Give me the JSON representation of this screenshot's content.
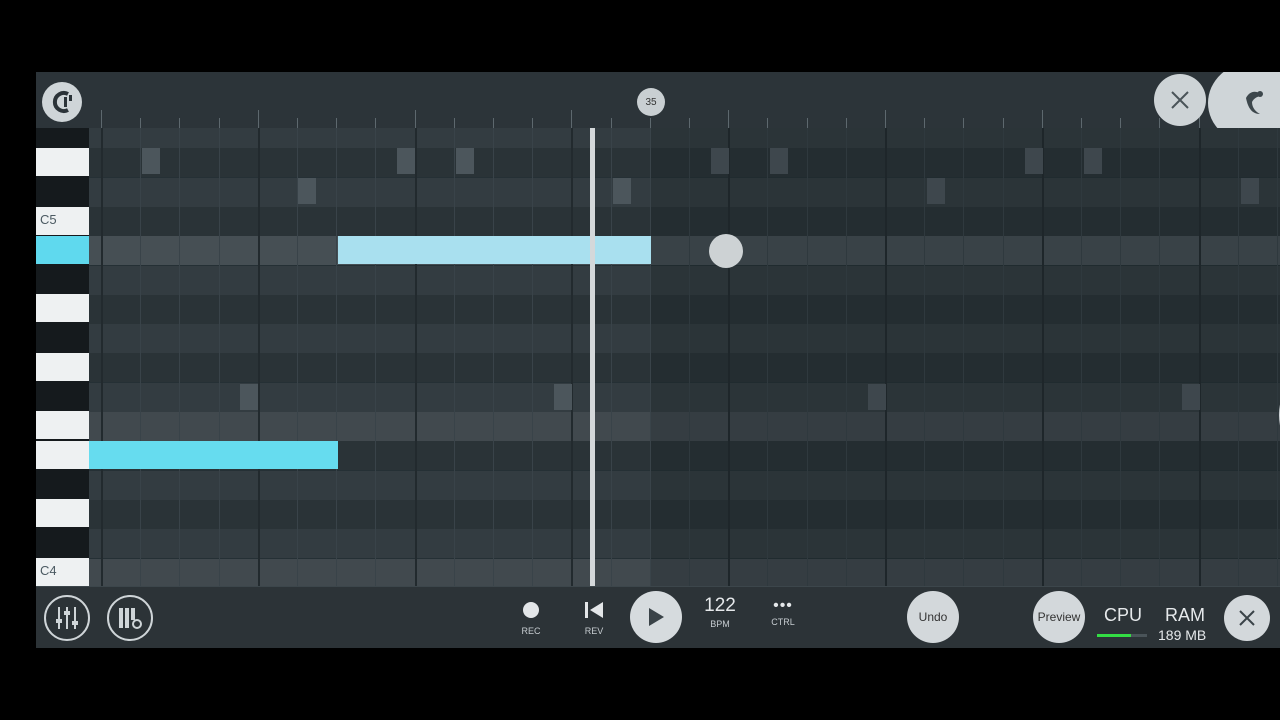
{
  "ruler": {
    "position_marker": "35"
  },
  "keys": {
    "label_c5": "C5",
    "label_c4": "C4"
  },
  "transport": {
    "rec_label": "REC",
    "rev_label": "REV",
    "bpm_value": "122",
    "bpm_label": "BPM",
    "ctrl_label": "CTRL",
    "ctrl_symbol": "•••"
  },
  "actions": {
    "undo_label": "Undo",
    "preview_label": "Preview"
  },
  "status": {
    "cpu_label": "CPU",
    "ram_label": "RAM",
    "ram_value": "189 MB"
  },
  "colors": {
    "accent": "#66dcef",
    "note_active": "#a9e0ef",
    "cpu_meter": "#33dd44"
  }
}
